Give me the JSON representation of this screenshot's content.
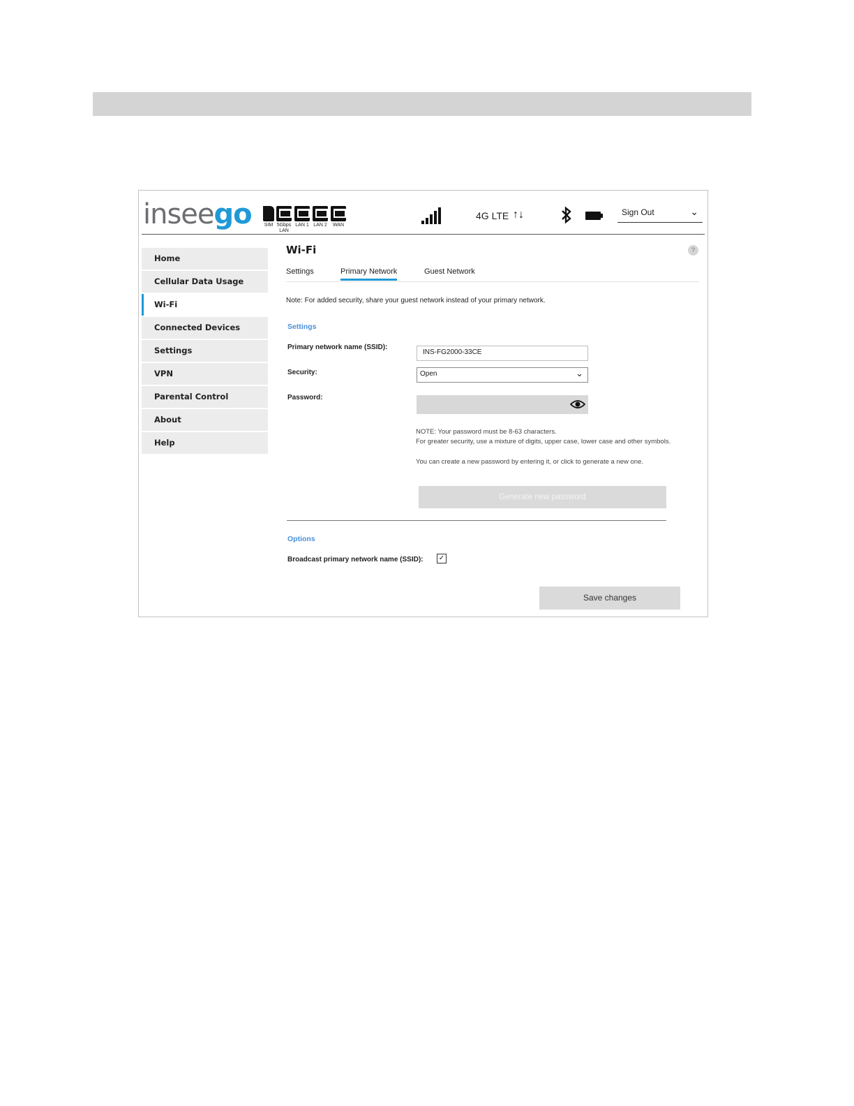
{
  "header": {
    "logo_part1": "insee",
    "logo_part2": "go",
    "ports": [
      {
        "label": "SIM",
        "icon": "sim-icon"
      },
      {
        "label": "5Gbps LAN",
        "icon": "ethernet-port-icon"
      },
      {
        "label": "LAN 1",
        "icon": "ethernet-port-icon"
      },
      {
        "label": "LAN 2",
        "icon": "ethernet-port-icon"
      },
      {
        "label": "WAN",
        "icon": "ethernet-port-icon"
      }
    ],
    "signal_icon": "signal-bars-icon",
    "network_type": "4G LTE",
    "data_arrows": "↑↓",
    "bluetooth_icon": "bluetooth-icon",
    "battery_icon": "battery-icon",
    "sign_out": "Sign Out"
  },
  "sidebar": {
    "items": [
      {
        "label": "Home",
        "active": false
      },
      {
        "label": "Cellular Data Usage",
        "active": false
      },
      {
        "label": "Wi-Fi",
        "active": true
      },
      {
        "label": "Connected Devices",
        "active": false
      },
      {
        "label": "Settings",
        "active": false
      },
      {
        "label": "VPN",
        "active": false
      },
      {
        "label": "Parental Control",
        "active": false
      },
      {
        "label": "About",
        "active": false
      },
      {
        "label": "Help",
        "active": false
      }
    ]
  },
  "main": {
    "title": "Wi-Fi",
    "help": "?",
    "tabs": [
      {
        "label": "Settings",
        "active": false
      },
      {
        "label": "Primary Network",
        "active": true
      },
      {
        "label": "Guest Network",
        "active": false
      }
    ],
    "note": "Note: For added security, share your guest network instead of your primary network.",
    "settings_heading": "Settings",
    "ssid_label": "Primary network name (SSID):",
    "ssid_value": "INS-FG2000-33CE",
    "security_label": "Security:",
    "security_value": "Open",
    "password_label": "Password:",
    "password_value": "",
    "password_note1": "NOTE: Your password must be 8-63 characters.",
    "password_note2": "For greater security, use a mixture of digits, upper case, lower case and other symbols.",
    "password_note3": "You can create a new password by entering it, or click to generate a new one.",
    "generate_button": "Generate new password",
    "options_heading": "Options",
    "broadcast_label": "Broadcast primary network name (SSID):",
    "broadcast_checked": true,
    "checkmark": "✓",
    "save_button": "Save changes"
  },
  "colors": {
    "accent": "#1f9ad6",
    "section_heading": "#4a90d9",
    "button_bg": "#dadada",
    "top_bar": "#d4d4d4"
  }
}
